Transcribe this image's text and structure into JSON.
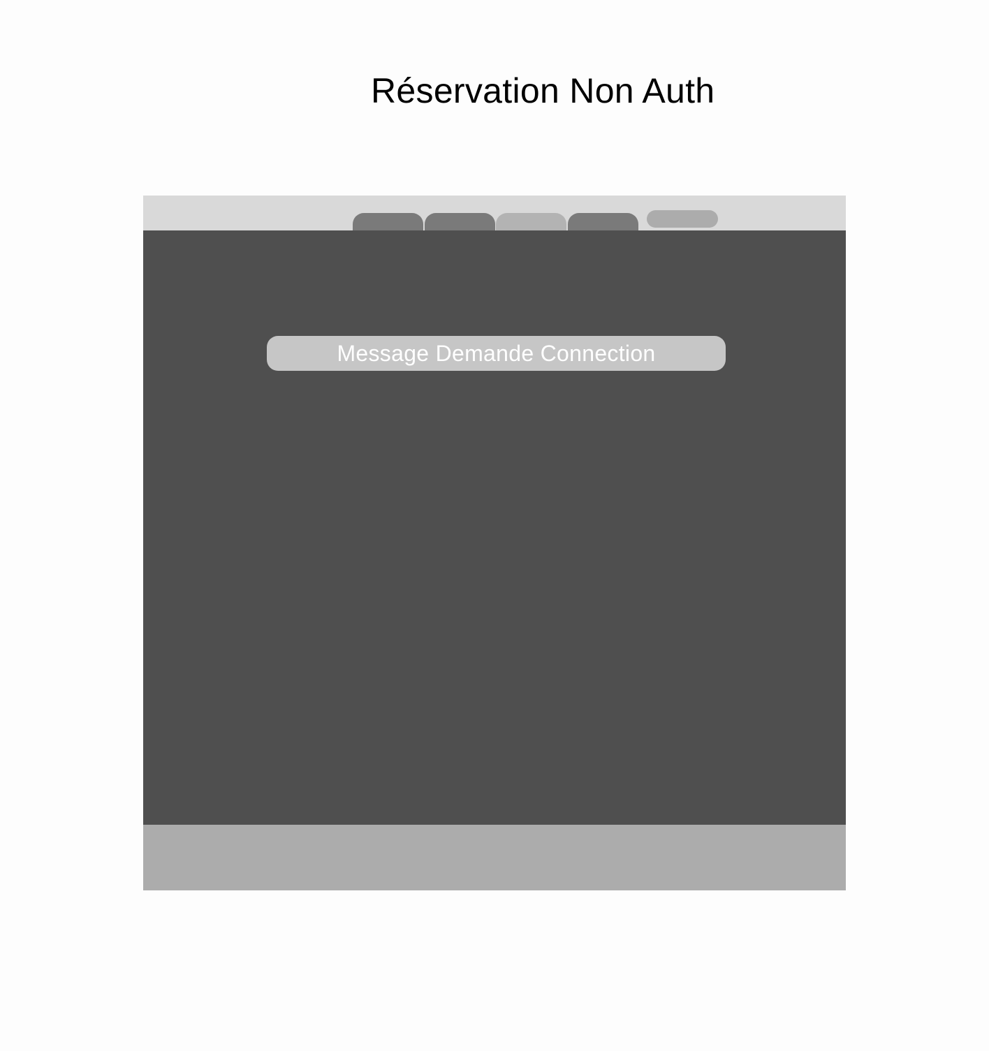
{
  "page": {
    "title": "Réservation Non Auth"
  },
  "header": {
    "tabs": [
      {
        "label": "",
        "state": "default"
      },
      {
        "label": "",
        "state": "default"
      },
      {
        "label": "",
        "state": "active"
      },
      {
        "label": "",
        "state": "default"
      }
    ],
    "pill_button": {
      "label": ""
    }
  },
  "main": {
    "message": "Message Demande Connection"
  },
  "footer": {},
  "colors": {
    "page_background": "#fdfdfd",
    "header_background": "#d9d9d9",
    "tab_default": "#7a7a7a",
    "tab_active": "#b3b3b3",
    "pill_button": "#acacac",
    "main_background": "#4f4f4f",
    "message_background": "#c6c6c6",
    "message_text": "#ffffff",
    "footer_background": "#acacac"
  }
}
